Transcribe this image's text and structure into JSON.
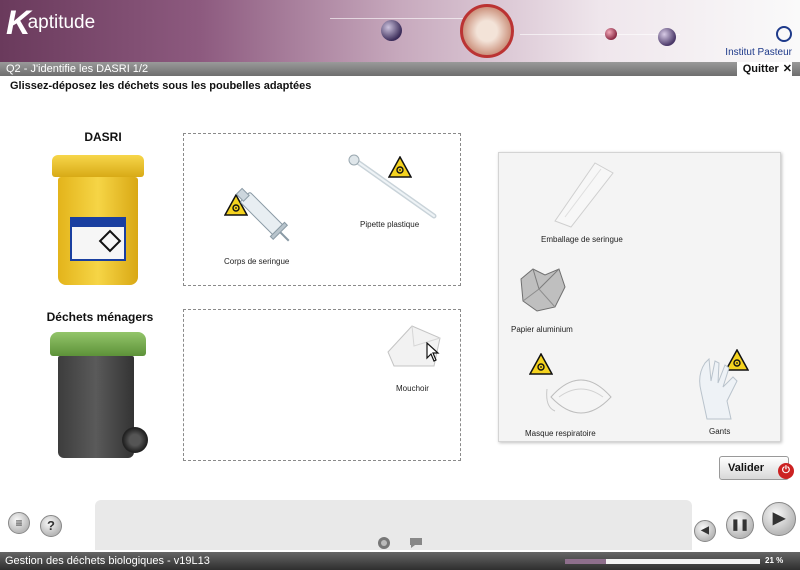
{
  "header": {
    "logo_initial": "K",
    "logo_rest": "aptitude",
    "partner": "Institut Pasteur"
  },
  "titlebar": {
    "question": "Q2 - J'identifie les DASRI 1/2",
    "quit_label": "Quitter",
    "quit_icon": "✕"
  },
  "instruction": "Glissez-déposez les déchets sous les poubelles adaptées",
  "bins": {
    "dasri_label": "DASRI",
    "menagers_label": "Déchets ménagers"
  },
  "zones": {
    "dasri": [
      {
        "label": "Corps de seringue",
        "biohazard": true
      },
      {
        "label": "Pipette plastique",
        "biohazard": true
      }
    ],
    "menagers": [
      {
        "label": "Mouchoir",
        "biohazard": false
      }
    ]
  },
  "tray": [
    {
      "label": "Emballage de seringue",
      "biohazard": false
    },
    {
      "label": "Papier aluminium",
      "biohazard": false
    },
    {
      "label": "Masque respiratoire",
      "biohazard": true
    },
    {
      "label": "Gants",
      "biohazard": true
    }
  ],
  "valider_label": "Valider",
  "footer": {
    "course_title": "Gestion des déchets biologiques - v19L13",
    "progress": 0.21,
    "progress_label": "21 %"
  },
  "colors": {
    "header_accent": "#6a3a5c",
    "biohazard_yellow": "#f5d31f",
    "dasri_yellow": "#f6d546",
    "household_green": "#5d9239",
    "progress": "#8e6f8c"
  }
}
